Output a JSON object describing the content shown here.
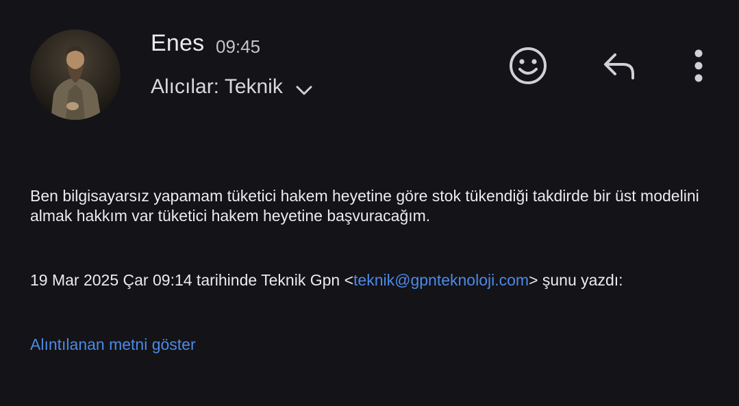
{
  "header": {
    "sender_name": "Enes",
    "time": "09:45",
    "recipients_label": "Alıcılar: Teknik"
  },
  "icons": {
    "expand": "chevron-down-icon",
    "emoji": "emoji-reaction-icon",
    "reply": "reply-icon",
    "more": "more-vert-icon"
  },
  "message": {
    "body": "Ben bilgisayarsız yapamam tüketici hakem heyetine göre stok tükendiği takdirde bir üst modelini almak hakkım var tüketici hakem heyetine başvuracağım.",
    "quote_prefix": "19 Mar 2025 Çar 09:14 tarihinde Teknik Gpn <",
    "quote_email": "teknik@gpnteknoloji.com",
    "quote_suffix": "> şunu yazdı:",
    "show_quoted_label": "Alıntılanan metni göster"
  },
  "colors": {
    "background": "#131318",
    "link": "#4d8ae6",
    "icon": "#d0d0d6"
  }
}
